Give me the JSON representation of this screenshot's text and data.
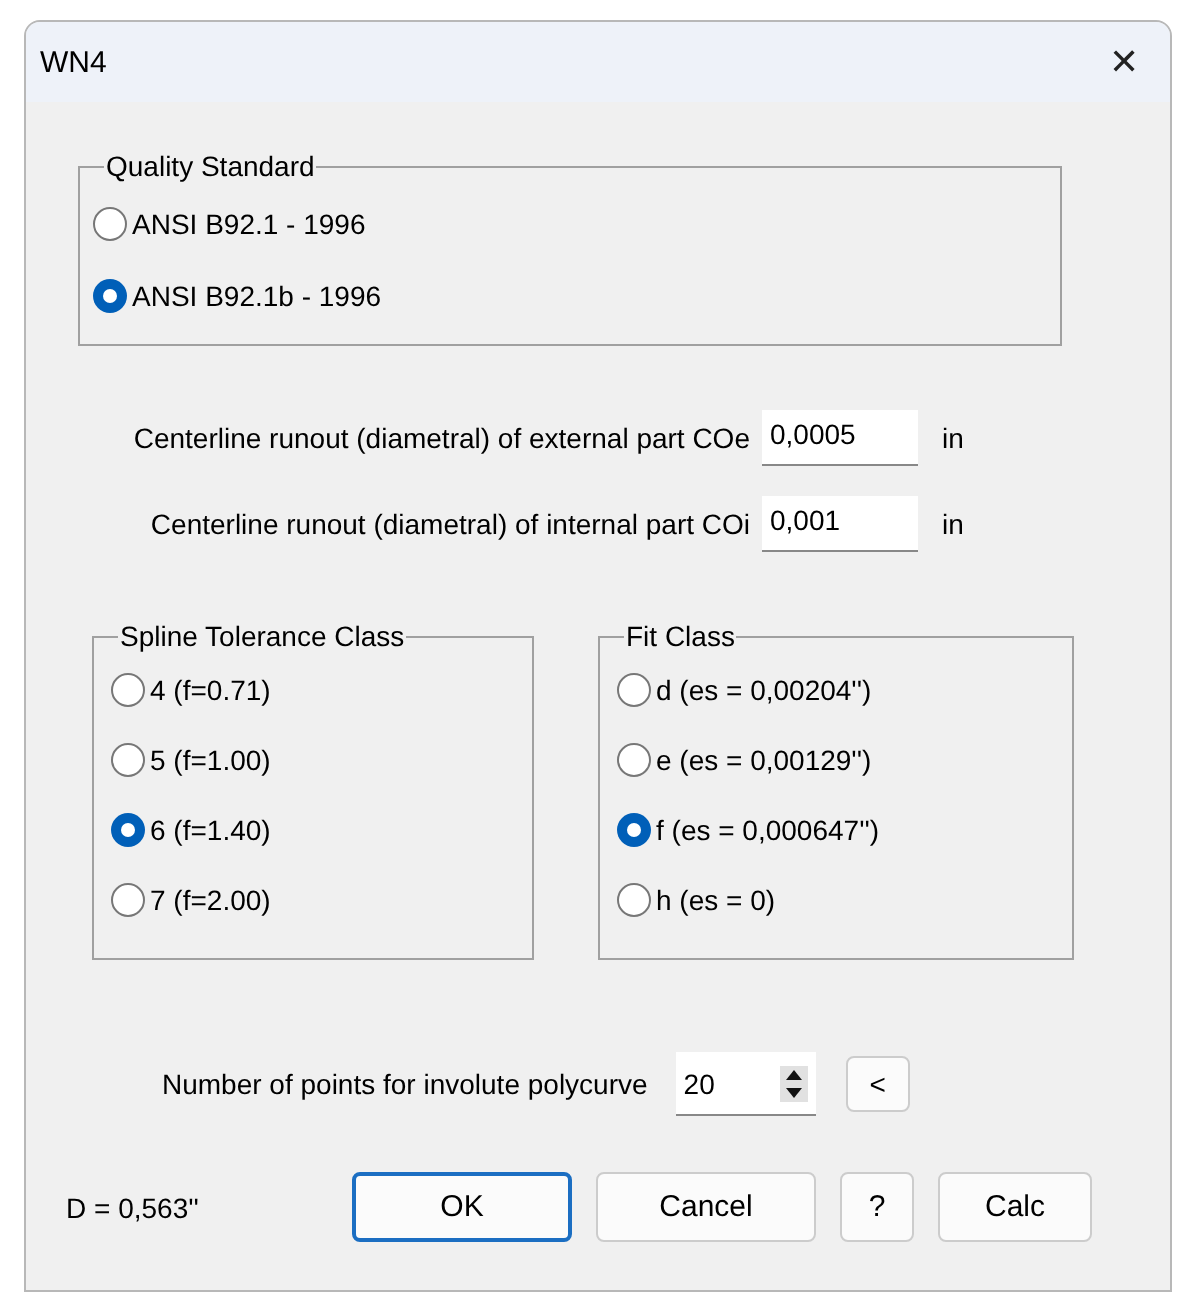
{
  "window": {
    "title": "WN4",
    "close": "✕"
  },
  "quality_standard": {
    "title": "Quality Standard",
    "options": [
      {
        "label": "ANSI B92.1 - 1996",
        "selected": false
      },
      {
        "label": "ANSI B92.1b - 1996",
        "selected": true
      }
    ]
  },
  "fields": [
    {
      "label": "Centerline runout (diametral) of external part  COe",
      "value": "0,0005",
      "unit": "in"
    },
    {
      "label": "Centerline runout (diametral) of internal part  COi",
      "value": "0,001",
      "unit": "in"
    }
  ],
  "spline_tolerance_class": {
    "title": "Spline Tolerance Class",
    "options": [
      {
        "label": "4  (f=0.71)",
        "selected": false
      },
      {
        "label": "5  (f=1.00)",
        "selected": false
      },
      {
        "label": "6  (f=1.40)",
        "selected": true
      },
      {
        "label": "7  (f=2.00)",
        "selected": false
      }
    ]
  },
  "fit_class": {
    "title": "Fit Class",
    "options": [
      {
        "label": "d (es = 0,00204'')",
        "selected": false
      },
      {
        "label": "e (es = 0,00129'')",
        "selected": false
      },
      {
        "label": "f (es = 0,000647'')",
        "selected": true
      },
      {
        "label": "h (es = 0)",
        "selected": false
      }
    ]
  },
  "points": {
    "label": "Number of points for involute polycurve",
    "value": "20",
    "side_button": "<"
  },
  "result": "D = 0,563''",
  "buttons": [
    {
      "label": "OK",
      "default": true
    },
    {
      "label": "Cancel",
      "default": false
    },
    {
      "label": "?",
      "default": false
    },
    {
      "label": "Calc",
      "default": false
    }
  ]
}
